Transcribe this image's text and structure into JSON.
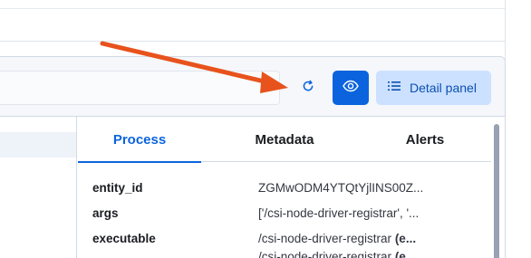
{
  "toolbar": {
    "refresh_icon": "refresh-icon",
    "eye_icon": "eye-icon",
    "detail_panel_label": "Detail panel",
    "detail_panel_icon": "list-icon"
  },
  "tabs": [
    {
      "label": "Process",
      "active": true
    },
    {
      "label": "Metadata",
      "active": false
    },
    {
      "label": "Alerts",
      "active": false
    }
  ],
  "fields": [
    {
      "key": "entity_id",
      "value": "ZGMwODM4YTQtYjlINS00Z..."
    },
    {
      "key": "args",
      "value": "['/csi-node-driver-registrar', '..."
    },
    {
      "key": "executable",
      "value": "/csi-node-driver-registrar",
      "value_suffix": "(e..."
    },
    {
      "key": "",
      "value": "/csi-node-driver-registrar",
      "value_suffix": "(e..."
    }
  ],
  "colors": {
    "primary": "#0b64dd",
    "annotation_arrow": "#e8521c",
    "secondary_button_bg": "#cce1ff"
  }
}
